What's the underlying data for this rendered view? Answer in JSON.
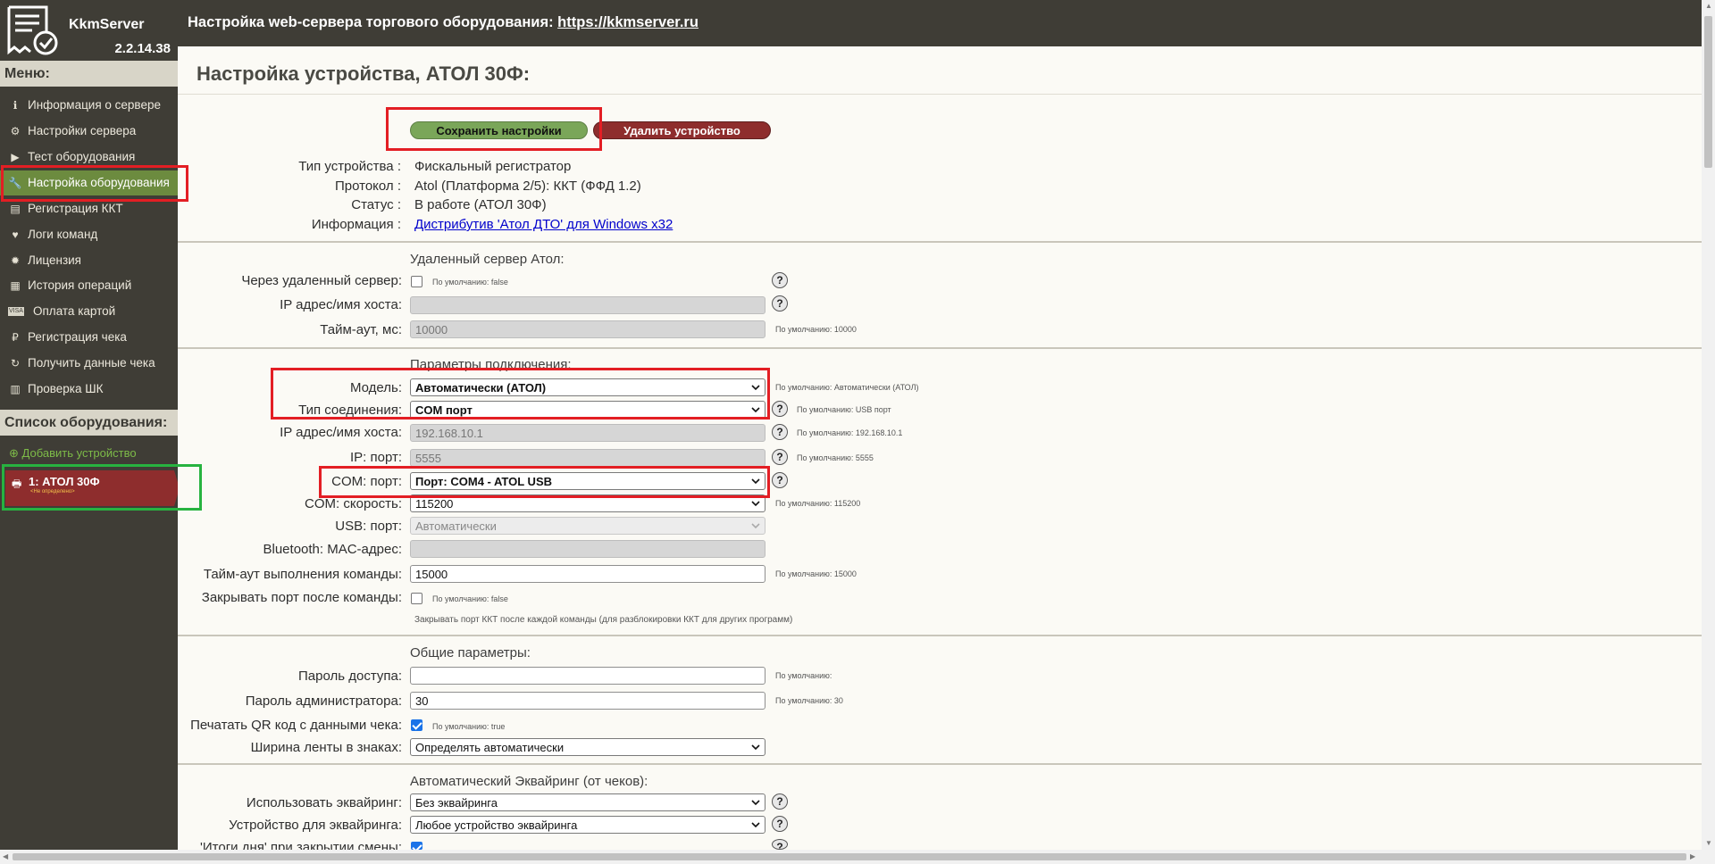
{
  "app": {
    "name": "KkmServer",
    "version": "2.2.14.38"
  },
  "topbar": {
    "title_prefix": "Настройка web-сервера торгового оборудования:",
    "link": "https://kkmserver.ru"
  },
  "sidebar": {
    "menu_header": "Меню:",
    "items": [
      {
        "label": "Информация о сервере",
        "icon": "info-icon"
      },
      {
        "label": "Настройки сервера",
        "icon": "gears-icon"
      },
      {
        "label": "Тест оборудования",
        "icon": "play-icon"
      },
      {
        "label": "Настройка оборудования",
        "icon": "wrench-icon"
      },
      {
        "label": "Регистрация ККТ",
        "icon": "register-icon"
      },
      {
        "label": "Логи команд",
        "icon": "heartbeat-icon"
      },
      {
        "label": "Лицензия",
        "icon": "certificate-icon"
      },
      {
        "label": "История операций",
        "icon": "calendar-icon"
      },
      {
        "label": "Оплата картой",
        "icon": "visa-icon"
      },
      {
        "label": "Регистрация чека",
        "icon": "receipt-icon"
      },
      {
        "label": "Получить данные чека",
        "icon": "refresh-icon"
      },
      {
        "label": "Проверка ШК",
        "icon": "barcode-icon"
      }
    ],
    "equipment_header": "Список оборудования:",
    "add_device": "Добавить устройство",
    "device": {
      "title": "1: АТОЛ 30Ф",
      "subtitle": "<Не определено>"
    }
  },
  "page_title": "Настройка устройства, АТОЛ 30Ф:",
  "buttons": {
    "save": "Сохранить настройки",
    "delete": "Удалить устройство"
  },
  "info": {
    "device_type_label": "Тип устройства :",
    "device_type": "Фискальный регистратор",
    "protocol_label": "Протокол :",
    "protocol": "Atol (Платформа 2/5): ККТ (ФФД 1.2)",
    "status_label": "Статус :",
    "status": "В работе (АТОЛ 30Ф)",
    "information_label": "Информация :",
    "information_link": "Дистрибутив 'Атол ДТО' для Windows x32"
  },
  "remote": {
    "section_title": "Удаленный сервер Атол:",
    "via_remote_label": "Через удаленный сервер:",
    "via_remote_hint": "По умолчанию: false",
    "ip_label": "IP адрес/имя хоста:",
    "ip_value": "",
    "timeout_label": "Тайм-аут, мс:",
    "timeout_value": "10000",
    "timeout_hint": "По умолчанию: 10000"
  },
  "connection": {
    "section_title": "Параметры подключения:",
    "model_label": "Модель:",
    "model_value": "Автоматически (АТОЛ)",
    "model_hint": "По умолчанию: Автоматически (АТОЛ)",
    "conn_type_label": "Тип соединения:",
    "conn_type_value": "COM порт",
    "conn_type_hint": "По умолчанию: USB порт",
    "ip_label": "IP адрес/имя хоста:",
    "ip_value": "192.168.10.1",
    "ip_hint": "По умолчанию: 192.168.10.1",
    "ip_port_label": "IP: порт:",
    "ip_port_value": "5555",
    "ip_port_hint": "По умолчанию: 5555",
    "com_port_label": "COM: порт:",
    "com_port_value": "Порт: COM4 - ATOL USB",
    "com_speed_label": "COM: скорость:",
    "com_speed_value": "115200",
    "com_speed_hint": "По умолчанию: 115200",
    "usb_port_label": "USB: порт:",
    "usb_port_value": "Автоматически",
    "bt_label": "Bluetooth: MAC-адрес:",
    "bt_value": "",
    "cmd_timeout_label": "Тайм-аут выполнения команды:",
    "cmd_timeout_value": "15000",
    "cmd_timeout_hint": "По умолчанию: 15000",
    "close_port_label": "Закрывать порт после команды:",
    "close_port_hint": "По умолчанию: false",
    "close_port_note": "Закрывать порт ККТ после каждой команды (для разблокировки ККТ для других программ)"
  },
  "general": {
    "section_title": "Общие параметры:",
    "access_pwd_label": "Пароль доступа:",
    "access_pwd_value": "",
    "access_pwd_hint": "По умолчанию:",
    "admin_pwd_label": "Пароль администратора:",
    "admin_pwd_value": "30",
    "admin_pwd_hint": "По умолчанию: 30",
    "print_qr_label": "Печатать QR код с данными чека:",
    "print_qr_hint": "По умолчанию: true",
    "tape_width_label": "Ширина ленты в знаках:",
    "tape_width_value": "Определять автоматически"
  },
  "acquiring": {
    "section_title": "Автоматический Эквайринг (от чеков):",
    "use_label": "Использовать эквайринг:",
    "use_value": "Без эквайринга",
    "device_label": "Устройство для эквайринга:",
    "device_value": "Любое устройство эквайринга",
    "totals_label": "'Итоги дня' при закрытии смены:"
  },
  "help_glyph": "?"
}
